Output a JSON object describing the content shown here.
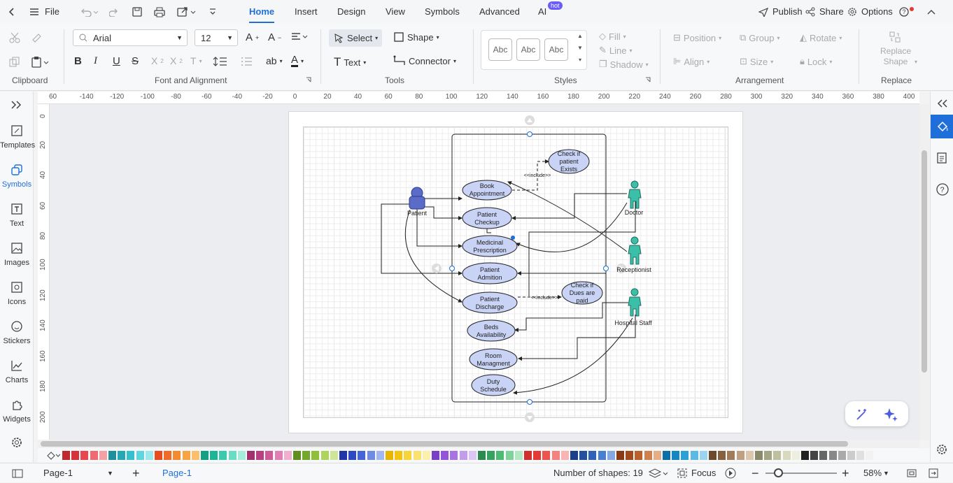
{
  "titlebar": {
    "file": "File"
  },
  "menu": {
    "tabs": [
      {
        "label": "Home",
        "active": true
      },
      {
        "label": "Insert"
      },
      {
        "label": "Design"
      },
      {
        "label": "View"
      },
      {
        "label": "Symbols"
      },
      {
        "label": "Advanced"
      },
      {
        "label": "AI"
      }
    ],
    "hot_badge": "hot",
    "publish": "Publish",
    "share": "Share",
    "options": "Options"
  },
  "ribbon": {
    "clipboard_label": "Clipboard",
    "font": {
      "family": "Arial",
      "size": "12"
    },
    "font_label": "Font and Alignment",
    "select": "Select",
    "shape": "Shape",
    "text": "Text",
    "connector": "Connector",
    "tools_label": "Tools",
    "style_sample": "Abc",
    "fill": "Fill",
    "line": "Line",
    "shadow": "Shadow",
    "styles_label": "Styles",
    "position": "Position",
    "group": "Group",
    "rotate": "Rotate",
    "align": "Align",
    "size": "Size",
    "lock": "Lock",
    "arrangement_label": "Arrangement",
    "replace_shape": "Replace Shape",
    "replace_label": "Replace"
  },
  "leftbar": {
    "items": [
      {
        "label": "Templates",
        "icon": "templates-icon"
      },
      {
        "label": "Symbols",
        "icon": "symbols-icon",
        "active": true
      },
      {
        "label": "Text",
        "icon": "text-icon"
      },
      {
        "label": "Images",
        "icon": "images-icon"
      },
      {
        "label": "Icons",
        "icon": "icons-icon"
      },
      {
        "label": "Stickers",
        "icon": "stickers-icon"
      },
      {
        "label": "Charts",
        "icon": "charts-icon"
      },
      {
        "label": "Widgets",
        "icon": "widgets-icon"
      }
    ]
  },
  "ruler": {
    "top": [
      "60",
      "-140",
      "-120",
      "-100",
      "-80",
      "-60",
      "-40",
      "-20",
      "0",
      "20",
      "40",
      "60",
      "80",
      "100",
      "120",
      "140",
      "160",
      "180",
      "200",
      "220",
      "240",
      "260",
      "280",
      "300",
      "320",
      "340",
      "360",
      "380",
      "400"
    ],
    "left": [
      "0",
      "20",
      "40",
      "60",
      "80",
      "100",
      "120",
      "140",
      "160",
      "180",
      "200"
    ]
  },
  "diagram": {
    "actors": {
      "patient": "Patient",
      "doctor": "Doctor",
      "receptionist": "Receptionist",
      "hospital_staff": "Hospital Staff"
    },
    "usecases": {
      "check_patient_1": "Check if",
      "check_patient_2": "patient",
      "check_patient_3": "Exists",
      "book_1": "Book",
      "book_2": "Appointment",
      "checkup_1": "Patient",
      "checkup_2": "Checkup",
      "medicinal_1": "Medicinal",
      "medicinal_2": "Prescription",
      "admition_1": "Patient",
      "admition_2": "Admition",
      "discharge_1": "Patient",
      "discharge_2": "Discharge",
      "dues_1": "Check if",
      "dues_2": "Dues are",
      "dues_3": "paid",
      "beds_1": "Beds",
      "beds_2": "Availability",
      "room_1": "Room",
      "room_2": "Managment",
      "duty_1": "Duty",
      "duty_2": "Schedule"
    },
    "include_label": "<<include>>"
  },
  "colors": {
    "accent": "#1e6fd9",
    "usecase_fill": "#c8d3f5",
    "actor_patient": "#5a6cc8",
    "actor_staff": "#3bbfa8"
  },
  "palette": [
    "#c0282d",
    "#d6323a",
    "#e8474f",
    "#ef6b73",
    "#f4a1a6",
    "#1f8f9e",
    "#26a7b5",
    "#34c0cc",
    "#5dd6dd",
    "#9ce8ec",
    "#e84c1e",
    "#f06a2a",
    "#f58b2f",
    "#f8a443",
    "#fbbf6e",
    "#14a085",
    "#1db598",
    "#3cc9ad",
    "#6cdbc4",
    "#a6ecdd",
    "#a0306e",
    "#b83f82",
    "#cf5a98",
    "#e07fb1",
    "#efb0d0",
    "#5e8f1f",
    "#74a82a",
    "#8fc03a",
    "#aed45c",
    "#cfe59a",
    "#2036a8",
    "#2c4ac2",
    "#4565d6",
    "#6f8be3",
    "#a4b6f0",
    "#e8b400",
    "#f2c40f",
    "#f7d43a",
    "#fbe270",
    "#fdf0ac",
    "#7b3fc7",
    "#9354d8",
    "#a974e2",
    "#c29dec",
    "#dcc6f5",
    "#2b8a4e",
    "#35a25d",
    "#4dbb74",
    "#7fd39a",
    "#b4e8c4",
    "#d32f2f",
    "#e53935",
    "#ef5350",
    "#f48380",
    "#f9b5b3",
    "#1c3f8a",
    "#24509e",
    "#2f63b8",
    "#4a7fd0",
    "#84a8e2",
    "#8a3a12",
    "#a24a1c",
    "#bb5f2c",
    "#d07f4e",
    "#e5ad88",
    "#0e6fa8",
    "#1486c4",
    "#2b9fd8",
    "#5cb9e4",
    "#9ad4f0",
    "#6b4a2e",
    "#86603f",
    "#a07c5a",
    "#bfa081",
    "#dcc7ae",
    "#8a8a6a",
    "#a5a584",
    "#c0c0a0",
    "#d9d9c0",
    "#efefe0",
    "#222222",
    "#444444",
    "#666666",
    "#888888",
    "#aaaaaa",
    "#cccccc",
    "#e0e0e0",
    "#f2f2f2"
  ],
  "status": {
    "page_tab": "Page-1",
    "page_active": "Page-1",
    "shapes": "Number of shapes: 19",
    "focus": "Focus",
    "zoom": "58%"
  }
}
